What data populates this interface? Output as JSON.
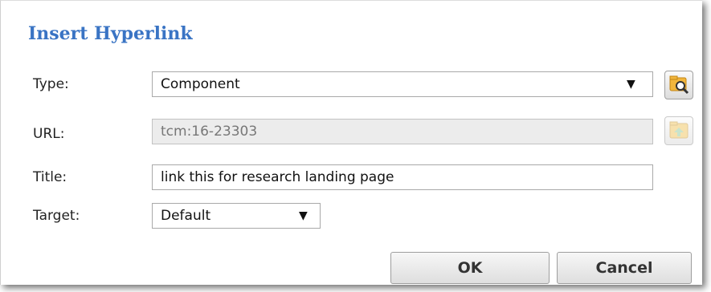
{
  "dialog": {
    "title": "Insert Hyperlink"
  },
  "type": {
    "label": "Type:",
    "value": "Component",
    "open_icon": "open-component-search-icon"
  },
  "url": {
    "label": "URL:",
    "value": "tcm:16-23303",
    "upload_icon": "folder-upload-icon"
  },
  "title_field": {
    "label": "Title:",
    "value": "link this for research landing page"
  },
  "target": {
    "label": "Target:",
    "value": "Default"
  },
  "buttons": {
    "ok": "OK",
    "cancel": "Cancel"
  },
  "colors": {
    "title": "#3a74c4"
  }
}
